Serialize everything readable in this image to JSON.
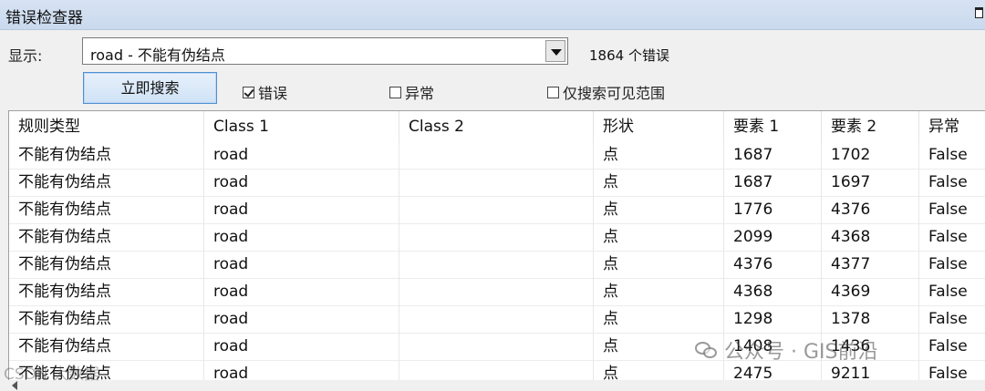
{
  "window": {
    "title": "错误检查器"
  },
  "toolbar": {
    "show_label": "显示:",
    "filter_value": "road - 不能有伪结点",
    "error_count": "1864 个错误",
    "search_button": "立即搜索",
    "checkbox_errors": {
      "label": "错误",
      "checked": true
    },
    "checkbox_exceptions": {
      "label": "异常",
      "checked": false
    },
    "checkbox_visible_extent": {
      "label": "仅搜索可见范围",
      "checked": false
    }
  },
  "table": {
    "headers": [
      "规则类型",
      "Class 1",
      "Class 2",
      "形状",
      "要素 1",
      "要素 2",
      "异常"
    ],
    "rows": [
      [
        "不能有伪结点",
        "road",
        "",
        "点",
        "1687",
        "1702",
        "False"
      ],
      [
        "不能有伪结点",
        "road",
        "",
        "点",
        "1687",
        "1697",
        "False"
      ],
      [
        "不能有伪结点",
        "road",
        "",
        "点",
        "1776",
        "4376",
        "False"
      ],
      [
        "不能有伪结点",
        "road",
        "",
        "点",
        "2099",
        "4368",
        "False"
      ],
      [
        "不能有伪结点",
        "road",
        "",
        "点",
        "4376",
        "4377",
        "False"
      ],
      [
        "不能有伪结点",
        "road",
        "",
        "点",
        "4368",
        "4369",
        "False"
      ],
      [
        "不能有伪结点",
        "road",
        "",
        "点",
        "1298",
        "1378",
        "False"
      ],
      [
        "不能有伪结点",
        "road",
        "",
        "点",
        "1408",
        "1436",
        "False"
      ],
      [
        "不能有伪结点",
        "road",
        "",
        "点",
        "2475",
        "9211",
        "False"
      ]
    ]
  },
  "watermarks": {
    "main": "公众号 · GIS前沿",
    "side": "CSDN 大数据"
  }
}
